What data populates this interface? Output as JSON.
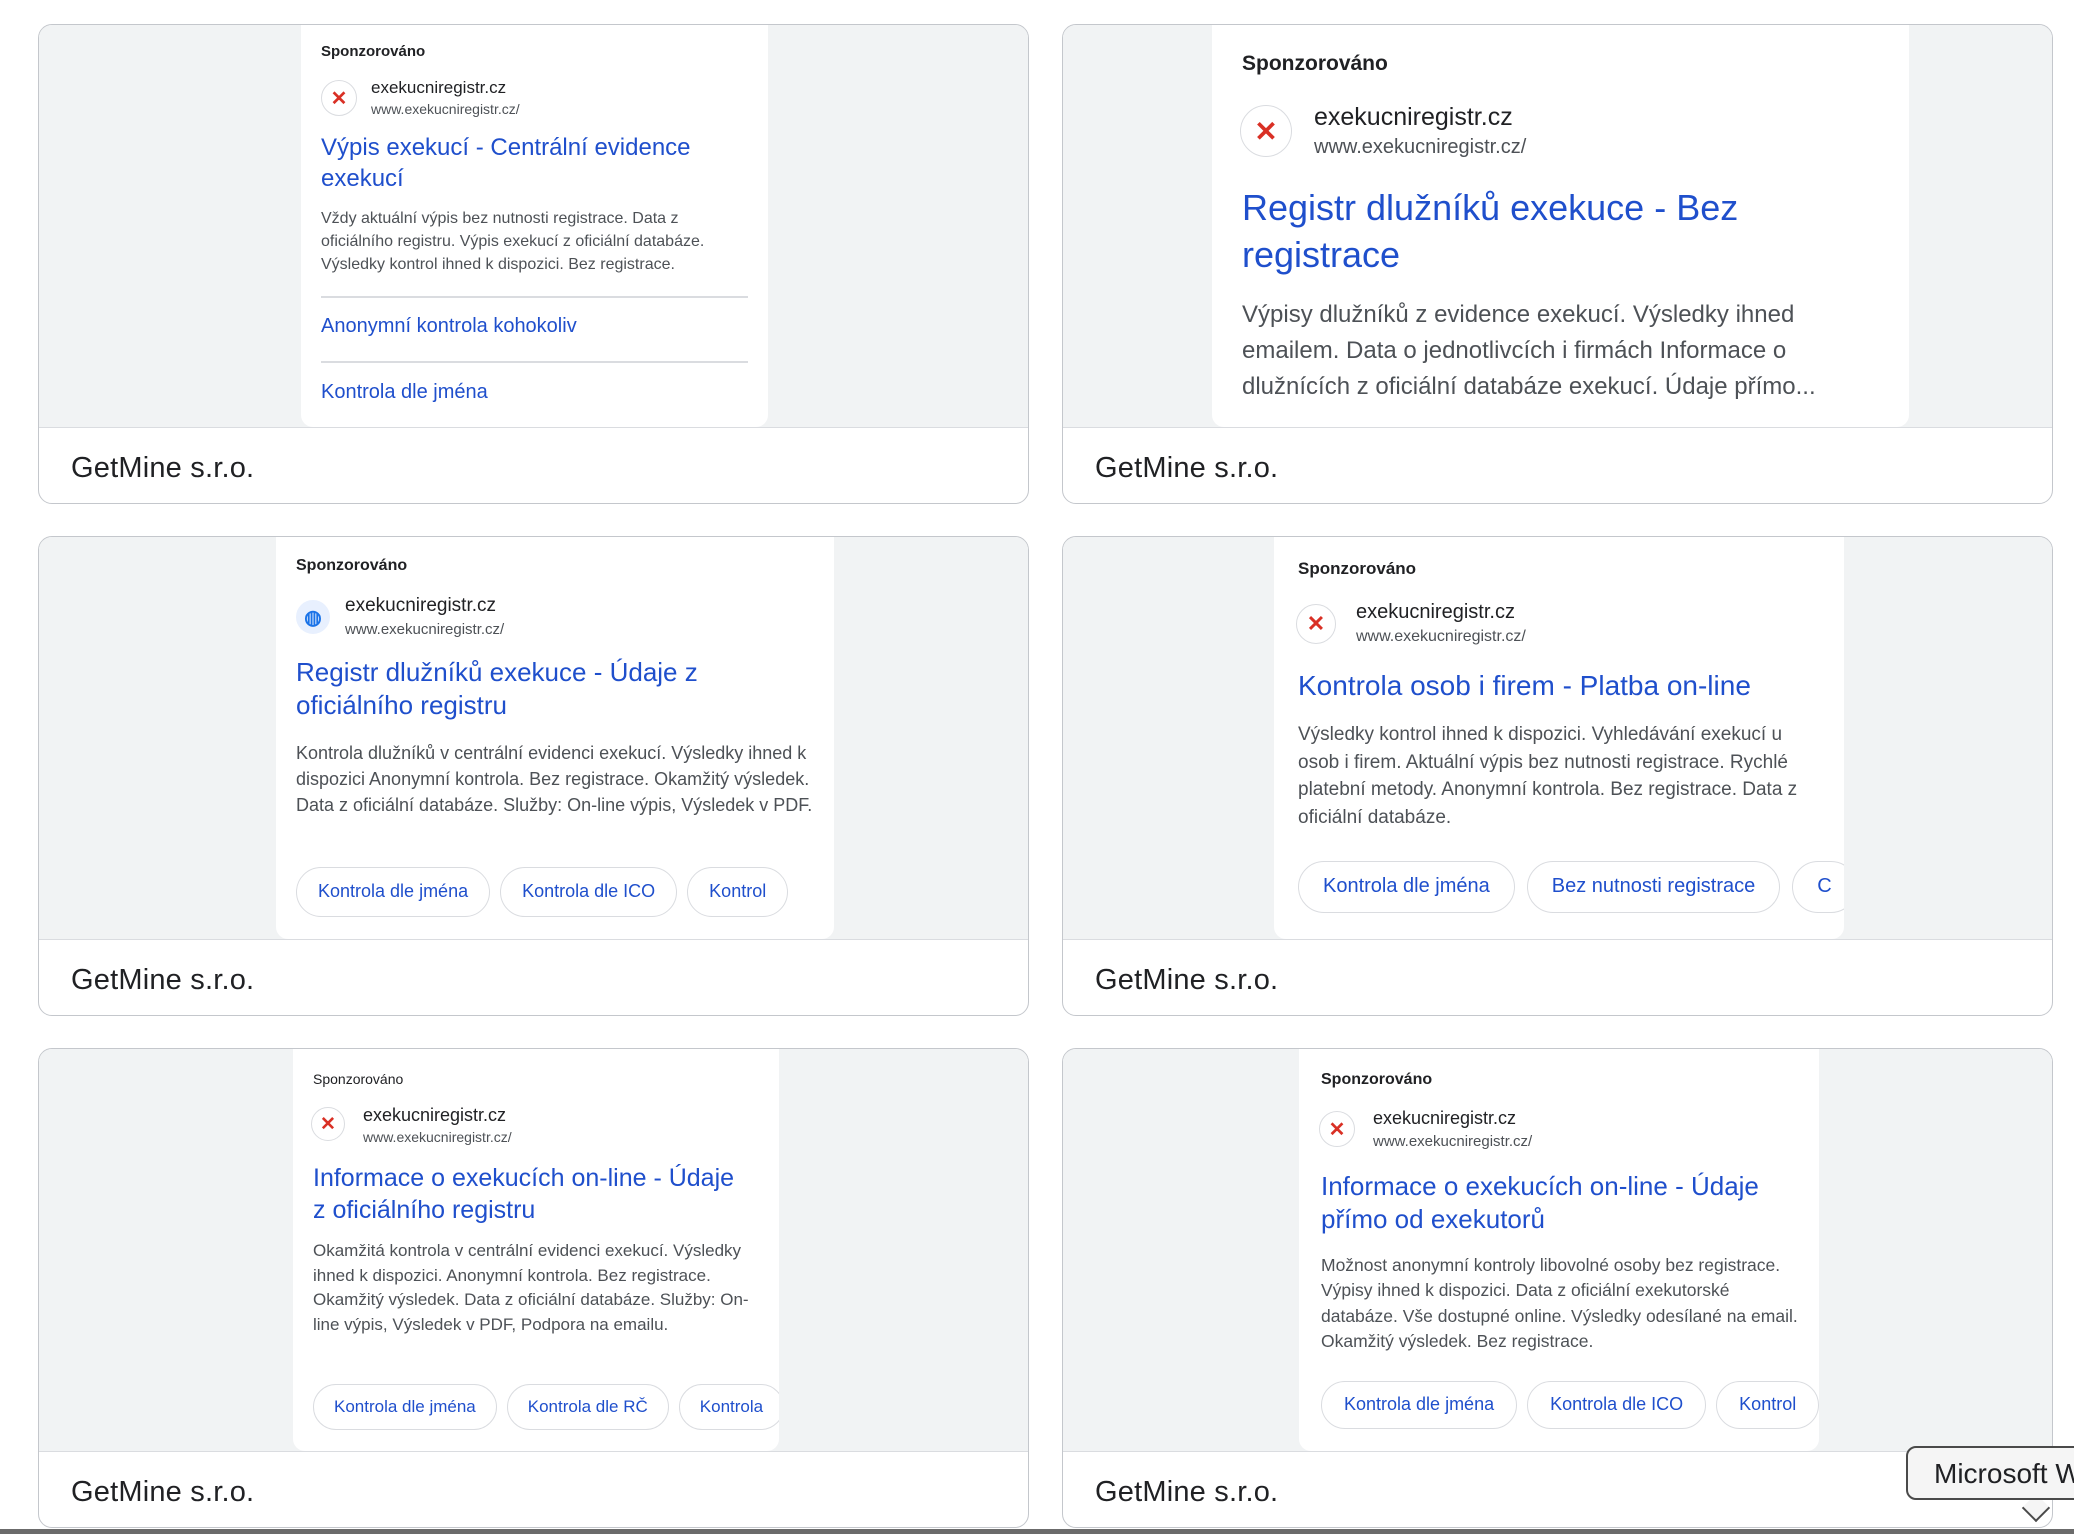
{
  "cards": [
    {
      "advertiser": "GetMine s.r.o.",
      "ad": {
        "sponsored": "Sponzorováno",
        "site_name": "exekucniregistr.cz",
        "site_url": "www.exekucniregistr.cz/",
        "favicon": "x-icon",
        "title": "Výpis exekucí - Centrální evidence exekucí",
        "description": "Vždy aktuální výpis bez nutnosti registrace. Data z oficiálního registru. Výpis exekucí z oficiální databáze. Výsledky kontrol ihned k dispozici. Bez registrace.",
        "sitelinks": [
          "Anonymní kontrola kohokoliv",
          "Kontrola dle jména"
        ]
      }
    },
    {
      "advertiser": "GetMine s.r.o.",
      "ad": {
        "sponsored": "Sponzorováno",
        "site_name": "exekucniregistr.cz",
        "site_url": "www.exekucniregistr.cz/",
        "favicon": "x-icon",
        "title": "Registr dlužníků exekuce - Bez registrace",
        "description": "Výpisy dlužníků z evidence exekucí. Výsledky ihned emailem. Data o jednotlivcích i firmách Informace o dlužnících z oficiální databáze exekucí. Údaje přímo..."
      }
    },
    {
      "advertiser": "GetMine s.r.o.",
      "ad": {
        "sponsored": "Sponzorováno",
        "site_name": "exekucniregistr.cz",
        "site_url": "www.exekucniregistr.cz/",
        "favicon": "globe-icon",
        "title": "Registr dlužníků exekuce - Údaje z oficiálního registru",
        "description": "Kontrola dlužníků v centrální evidenci exekucí. Výsledky ihned k dispozici Anonymní kontrola. Bez registrace. Okamžitý výsledek. Data z oficiální databáze. Služby: On-line výpis, Výsledek v PDF.",
        "chips": [
          "Kontrola dle jména",
          "Kontrola dle ICO",
          "Kontrol"
        ]
      }
    },
    {
      "advertiser": "GetMine s.r.o.",
      "ad": {
        "sponsored": "Sponzorováno",
        "site_name": "exekucniregistr.cz",
        "site_url": "www.exekucniregistr.cz/",
        "favicon": "x-icon",
        "title": "Kontrola osob i firem - Platba on-line",
        "description": "Výsledky kontrol ihned k dispozici. Vyhledávání exekucí u osob i firem. Aktuální výpis bez nutnosti registrace. Rychlé platební metody. Anonymní kontrola. Bez registrace. Data z oficiální databáze.",
        "chips": [
          "Kontrola dle jména",
          "Bez nutnosti registrace",
          "C"
        ]
      }
    },
    {
      "advertiser": "GetMine s.r.o.",
      "ad": {
        "sponsored": "Sponzorováno",
        "site_name": "exekucniregistr.cz",
        "site_url": "www.exekucniregistr.cz/",
        "favicon": "x-icon",
        "title": "Informace o exekucích on-line - Údaje z oficiálního registru",
        "description": "Okamžitá kontrola v centrální evidenci exekucí. Výsledky ihned k dispozici. Anonymní kontrola. Bez registrace. Okamžitý výsledek. Data z oficiální databáze. Služby: On-line výpis, Výsledek v PDF, Podpora na emailu.",
        "chips": [
          "Kontrola dle jména",
          "Kontrola dle RČ",
          "Kontrola"
        ]
      }
    },
    {
      "advertiser": "GetMine s.r.o.",
      "ad": {
        "sponsored": "Sponzorováno",
        "site_name": "exekucniregistr.cz",
        "site_url": "www.exekucniregistr.cz/",
        "favicon": "x-icon",
        "title": "Informace o exekucích on-line - Údaje přímo od exekutorů",
        "description": "Možnost anonymní kontroly libovolné osoby bez registrace. Výpisy ihned k dispozici. Data z oficiální exekutorské databáze. Vše dostupné online. Výsledky odesílané na email. Okamžitý výsledek. Bez registrace.",
        "chips": [
          "Kontrola dle jména",
          "Kontrola dle ICO",
          "Kontrol"
        ]
      }
    }
  ],
  "tooltip": "Microsoft W"
}
